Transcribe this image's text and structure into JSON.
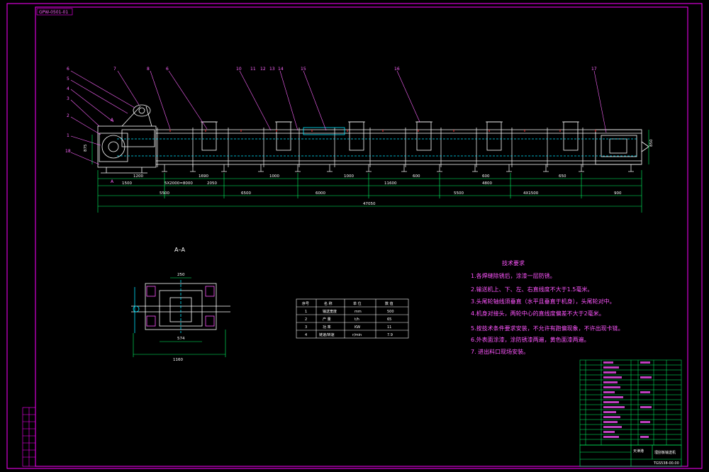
{
  "drawing_code": "GPW-0501-01",
  "section_label": "A–A",
  "part_callouts": [
    "6",
    "7",
    "8",
    "6",
    "10",
    "11",
    "12",
    "13",
    "14",
    "15",
    "16",
    "17",
    "5",
    "4",
    "3",
    "2",
    "1",
    "18"
  ],
  "cut_mark": "A",
  "dimensions": {
    "top_row": [
      "1200",
      "1690",
      "1000",
      "600",
      "600",
      "650"
    ],
    "middle_row": [
      "1500",
      "5X2000=8000",
      "2050",
      "1000",
      "11600",
      "4800",
      "4X1500"
    ],
    "bottom_row": [
      "5500",
      "6500",
      "6000",
      "5500",
      "4X1500",
      "900"
    ],
    "total": "47050",
    "head_height": "875",
    "tail_height": "850",
    "section_top": "250",
    "section_inner": "574",
    "section_total": "1160"
  },
  "tech_requirements": {
    "title": "技术要求",
    "items": [
      "1.各焊缝除锈后，涂漆一层防锈。",
      "2.输送机上、下、左、右直线度不大于1.5毫米。",
      "3.头尾轮轴线须垂直（水平且垂直于机身），头尾轮对中。",
      "4.机身对接头，两轮中心的直线度偏差不大于2毫米。",
      "5.按技术条件要求安装，不允许有跑偏现象，不许出现卡链。",
      "6.外表面涂漆，涂防锈漆两遍，黄色面漆两遍。",
      "7. 进出料口现场安装。"
    ]
  },
  "param_table": {
    "headers": [
      "序号",
      "名 称",
      "单 位",
      "数 值"
    ],
    "rows": [
      [
        "1",
        "输送宽度",
        "mm",
        "500"
      ],
      [
        "2",
        "产 量",
        "t/h",
        "65"
      ],
      [
        "3",
        "功 率",
        "KW",
        "11"
      ],
      [
        "4",
        "链速/转速",
        "r/min",
        "7.9"
      ]
    ]
  },
  "title_block": {
    "company": "天津港",
    "drawing_name": "埋刮板输送机",
    "drawing_no": "TGS538-00.00"
  },
  "colors": {
    "frame": "#ff00ff",
    "machine": "#ffffff",
    "chain": "#00e5ff",
    "callout": "#ff66ff",
    "dimension": "#00ff66"
  }
}
